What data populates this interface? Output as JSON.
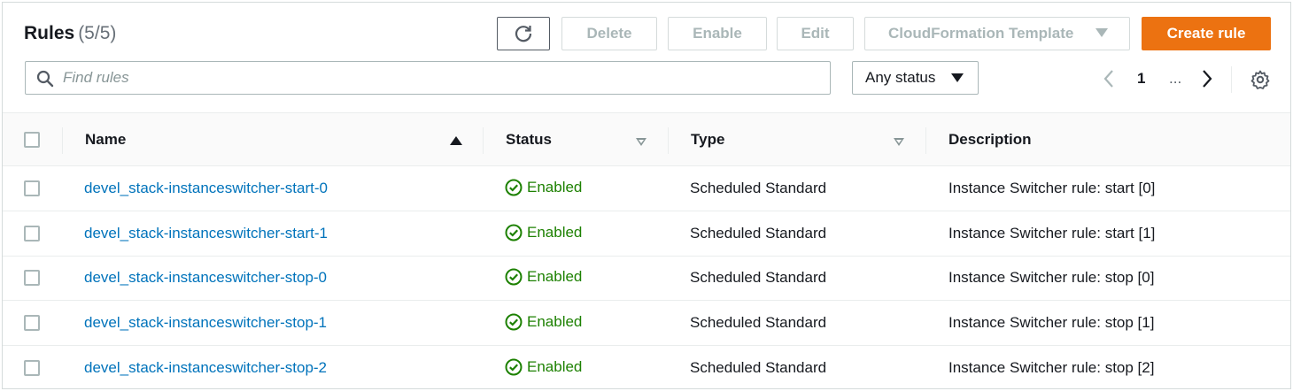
{
  "header": {
    "title": "Rules",
    "count": "(5/5)"
  },
  "toolbar": {
    "refresh_icon": "refresh-icon",
    "delete_label": "Delete",
    "enable_label": "Enable",
    "edit_label": "Edit",
    "cloudformation_label": "CloudFormation Template",
    "create_label": "Create rule"
  },
  "search": {
    "placeholder": "Find rules",
    "value": ""
  },
  "status_filter": {
    "selected": "Any status"
  },
  "pagination": {
    "current_page": "1",
    "ellipsis": "..."
  },
  "table": {
    "columns": [
      "Name",
      "Status",
      "Type",
      "Description"
    ],
    "rows": [
      {
        "name": "devel_stack-instanceswitcher-start-0",
        "status": "Enabled",
        "type": "Scheduled Standard",
        "description": "Instance Switcher rule: start [0]"
      },
      {
        "name": "devel_stack-instanceswitcher-start-1",
        "status": "Enabled",
        "type": "Scheduled Standard",
        "description": "Instance Switcher rule: start [1]"
      },
      {
        "name": "devel_stack-instanceswitcher-stop-0",
        "status": "Enabled",
        "type": "Scheduled Standard",
        "description": "Instance Switcher rule: stop [0]"
      },
      {
        "name": "devel_stack-instanceswitcher-stop-1",
        "status": "Enabled",
        "type": "Scheduled Standard",
        "description": "Instance Switcher rule: stop [1]"
      },
      {
        "name": "devel_stack-instanceswitcher-stop-2",
        "status": "Enabled",
        "type": "Scheduled Standard",
        "description": "Instance Switcher rule: stop [2]"
      }
    ]
  },
  "colors": {
    "primary_button": "#ec7211",
    "link": "#0073bb",
    "status_success": "#1d8102"
  }
}
